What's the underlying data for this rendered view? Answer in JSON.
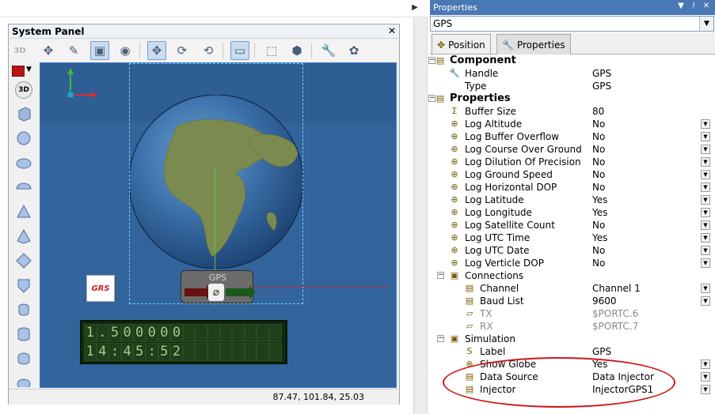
{
  "system_panel": {
    "title": "System Panel",
    "toolbar_3d_label": "3D",
    "palette_3d_label": "3D",
    "gps_block_label": "GPS",
    "grs_logo_text": "GRS",
    "lcd_line1": "1.500000",
    "lcd_line2": "14:45:52",
    "status_coords": "87.47, 101.84, 25.03"
  },
  "properties_panel": {
    "title": "Properties",
    "object_combo_value": "GPS",
    "tab_position": "Position",
    "tab_properties": "Properties",
    "rows": {
      "component": {
        "name": "Component"
      },
      "handle": {
        "name": "Handle",
        "value": "GPS"
      },
      "type": {
        "name": "Type",
        "value": "GPS"
      },
      "properties": {
        "name": "Properties"
      },
      "buffer_size": {
        "name": "Buffer Size",
        "value": "80"
      },
      "log_altitude": {
        "name": "Log Altitude",
        "value": "No"
      },
      "log_buffer_overflow": {
        "name": "Log Buffer Overflow",
        "value": "No"
      },
      "log_course_over_ground": {
        "name": "Log Course Over Ground",
        "value": "No"
      },
      "log_dilution_of_precision": {
        "name": "Log Dilution Of Precision",
        "value": "No"
      },
      "log_ground_speed": {
        "name": "Log Ground Speed",
        "value": "No"
      },
      "log_horizontal_dop": {
        "name": "Log Horizontal DOP",
        "value": "No"
      },
      "log_latitude": {
        "name": "Log Latitude",
        "value": "Yes"
      },
      "log_longitude": {
        "name": "Log Longitude",
        "value": "Yes"
      },
      "log_satellite_count": {
        "name": "Log Satellite Count",
        "value": "No"
      },
      "log_utc_time": {
        "name": "Log UTC Time",
        "value": "Yes"
      },
      "log_utc_date": {
        "name": "Log UTC Date",
        "value": "No"
      },
      "log_verticle_dop": {
        "name": "Log Verticle DOP",
        "value": "No"
      },
      "connections": {
        "name": "Connections"
      },
      "channel": {
        "name": "Channel",
        "value": "Channel 1"
      },
      "baud_list": {
        "name": "Baud List",
        "value": "9600"
      },
      "tx": {
        "name": "TX",
        "value": "$PORTC.6"
      },
      "rx": {
        "name": "RX",
        "value": "$PORTC.7"
      },
      "simulation": {
        "name": "Simulation"
      },
      "label": {
        "name": "Label",
        "value": "GPS"
      },
      "show_globe": {
        "name": "Show Globe",
        "value": "Yes"
      },
      "data_source": {
        "name": "Data Source",
        "value": "Data Injector"
      },
      "injector": {
        "name": "Injector",
        "value": "InjectorGPS1"
      }
    }
  },
  "colors": {
    "viewport_bg": "#2f5e94",
    "title_bar": "#4a78b4",
    "annotation_ellipse": "#d01818",
    "color_swatch": "#b81414"
  }
}
